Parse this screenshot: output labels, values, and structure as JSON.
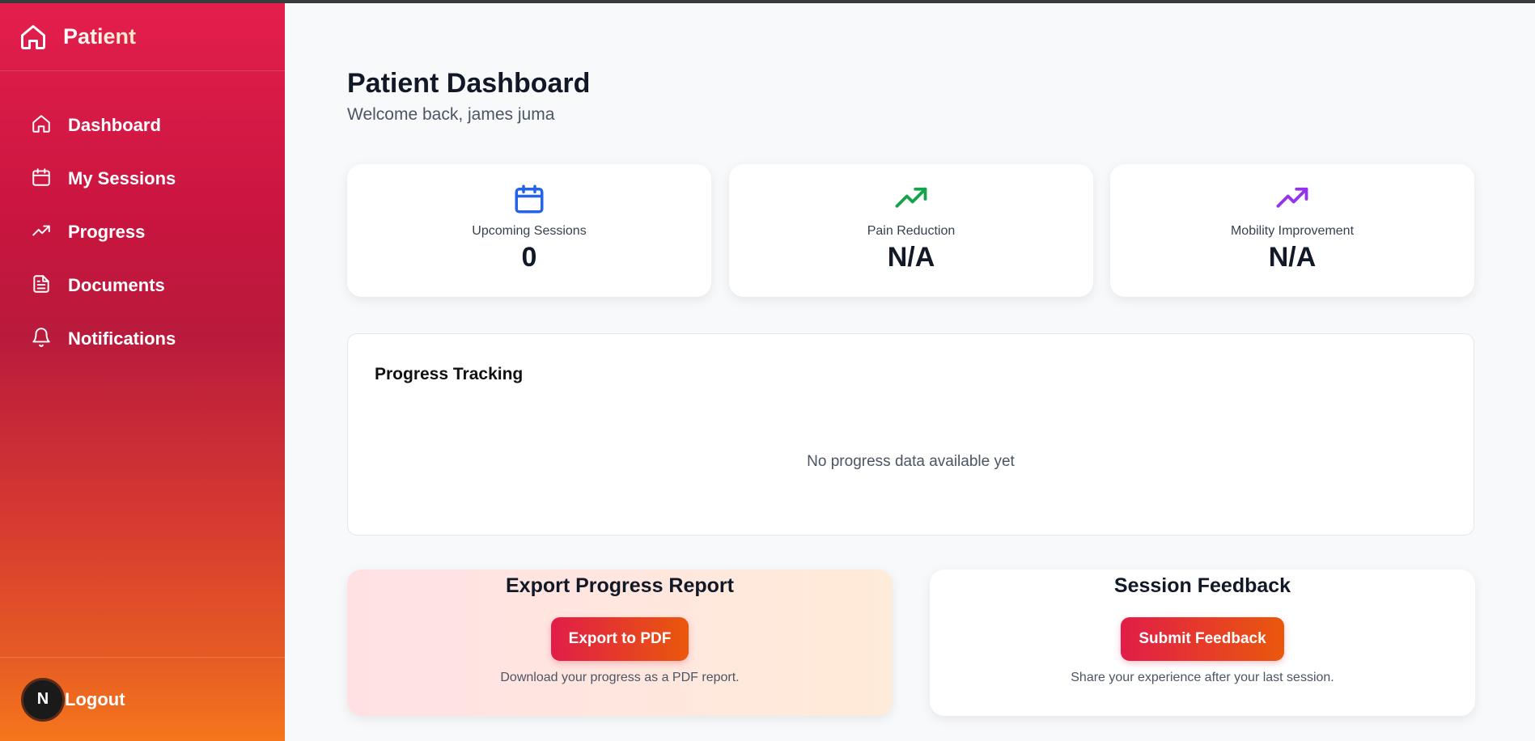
{
  "sidebar": {
    "brand": "Patient",
    "items": [
      {
        "label": "Dashboard",
        "icon": "home-icon"
      },
      {
        "label": "My Sessions",
        "icon": "calendar-icon"
      },
      {
        "label": "Progress",
        "icon": "trending-up-icon"
      },
      {
        "label": "Documents",
        "icon": "document-icon"
      },
      {
        "label": "Notifications",
        "icon": "bell-icon"
      }
    ],
    "avatar_initial": "N",
    "logout_label": "Logout"
  },
  "header": {
    "title": "Patient Dashboard",
    "subtitle": "Welcome back, james juma"
  },
  "stats": [
    {
      "label": "Upcoming Sessions",
      "value": "0",
      "icon": "calendar-icon",
      "color": "#2563eb"
    },
    {
      "label": "Pain Reduction",
      "value": "N/A",
      "icon": "trending-up-icon",
      "color": "#16a34a"
    },
    {
      "label": "Mobility Improvement",
      "value": "N/A",
      "icon": "trending-up-icon",
      "color": "#9333ea"
    }
  ],
  "progress": {
    "title": "Progress Tracking",
    "empty_message": "No progress data available yet"
  },
  "export": {
    "title": "Export Progress Report",
    "button": "Export to PDF",
    "note": "Download your progress as a PDF report."
  },
  "feedback": {
    "title": "Session Feedback",
    "button": "Submit Feedback",
    "note": "Share your experience after your last session."
  },
  "colors": {
    "brand_start": "#e41e4d",
    "brand_end": "#f5761c",
    "button_start": "#e11d48",
    "button_end": "#ea580c"
  }
}
